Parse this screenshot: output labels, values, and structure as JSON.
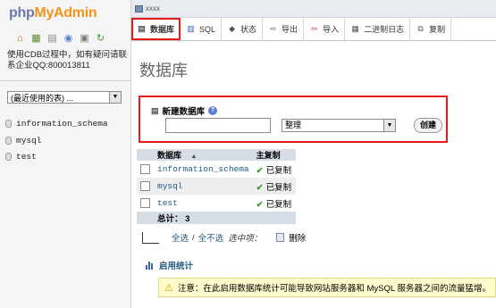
{
  "sidebar": {
    "logo": {
      "part1": "php",
      "part2": "MyAdmin"
    },
    "icons": [
      "home-icon",
      "exit-icon",
      "query-window-icon",
      "sql-doc-icon",
      "docs-icon",
      "reload-icon"
    ],
    "help_text": "使用CDB过程中，如有疑问请联系企业QQ:800013811",
    "recent_select": {
      "value": "(最近使用的表) ..."
    },
    "databases": [
      "information_schema",
      "mysql",
      "test"
    ]
  },
  "topbar": {
    "server": "xxxx"
  },
  "tabs": [
    {
      "label": "数据库",
      "icon": "database-icon",
      "active": true
    },
    {
      "label": "SQL",
      "icon": "sql-icon",
      "active": false
    },
    {
      "label": "状态",
      "icon": "status-icon",
      "active": false
    },
    {
      "label": "导出",
      "icon": "export-icon",
      "active": false
    },
    {
      "label": "导入",
      "icon": "import-icon",
      "active": false
    },
    {
      "label": "二进制日志",
      "icon": "binlog-icon",
      "active": false
    },
    {
      "label": "复制",
      "icon": "replication-icon",
      "active": false
    }
  ],
  "page_title": "数据库",
  "create_db": {
    "label": "新建数据库",
    "name_value": "",
    "collation_value": "整理",
    "button_label": "创建"
  },
  "db_table": {
    "headers": {
      "name": "数据库",
      "replication": "主复制"
    },
    "rows": [
      {
        "name": "information_schema",
        "replication": "已复制"
      },
      {
        "name": "mysql",
        "replication": "已复制"
      },
      {
        "name": "test",
        "replication": "已复制"
      }
    ],
    "total_label": "总计：",
    "total_count": "3"
  },
  "bulk": {
    "check_all": "全选",
    "separator": "/",
    "uncheck_all": "全不选",
    "with_selected": "选中项：",
    "delete_label": "删除"
  },
  "stats_label": "启用统计",
  "notice": "注意：在此启用数据库统计可能导致网站服务器和 MySQL 服务器之间的流量猛增。",
  "colors": {
    "accent_red": "#e81919",
    "link": "#235a81",
    "logo_blue": "#6c78af",
    "logo_orange": "#f29419"
  }
}
